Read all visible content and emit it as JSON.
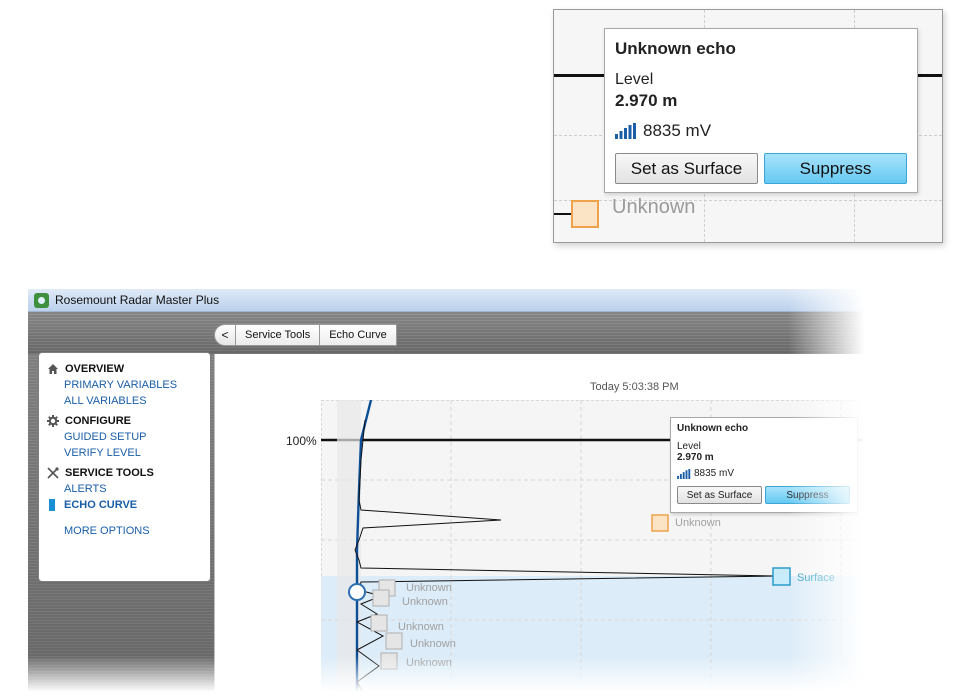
{
  "window": {
    "title": "Rosemount Radar Master Plus"
  },
  "breadcrumb": {
    "back": "<",
    "items": [
      "Service Tools",
      "Echo Curve"
    ]
  },
  "sidebar": {
    "sections": [
      {
        "title": "OVERVIEW",
        "icon": "home-icon",
        "links": [
          "PRIMARY VARIABLES",
          "ALL VARIABLES"
        ]
      },
      {
        "title": "CONFIGURE",
        "icon": "gear-icon",
        "links": [
          "GUIDED SETUP",
          "VERIFY LEVEL"
        ]
      },
      {
        "title": "SERVICE TOOLS",
        "icon": "tools-icon",
        "links": [
          "ALERTS",
          "ECHO CURVE"
        ]
      }
    ],
    "active": "ECHO CURVE",
    "more": "MORE OPTIONS"
  },
  "chart": {
    "timestamp": "Today 5:03:38 PM",
    "percent_label": "100%",
    "markers": [
      {
        "label": "Unknown",
        "type": "unknown"
      },
      {
        "label": "Surface",
        "type": "surface"
      },
      {
        "label": "Unknown",
        "type": "unknown"
      },
      {
        "label": "Unknown",
        "type": "unknown"
      },
      {
        "label": "Unknown",
        "type": "unknown"
      },
      {
        "label": "Unknown",
        "type": "unknown"
      },
      {
        "label": "Unknown",
        "type": "unknown"
      }
    ]
  },
  "popup": {
    "title": "Unknown echo",
    "level_label": "Level",
    "level_value": "2.970 m",
    "signal_icon": "signal-strength-icon",
    "amplitude": "8835 mV",
    "set_surface": "Set as Surface",
    "suppress": "Suppress"
  },
  "zoom_callout": {
    "marker_label": "Unknown"
  },
  "colors": {
    "accent": "#1a5ea8",
    "echo_marker": "#f0a24a",
    "surface_marker": "#2b9cc9",
    "suppress_button": "#66c9f2",
    "curve": "#0d4f96"
  }
}
